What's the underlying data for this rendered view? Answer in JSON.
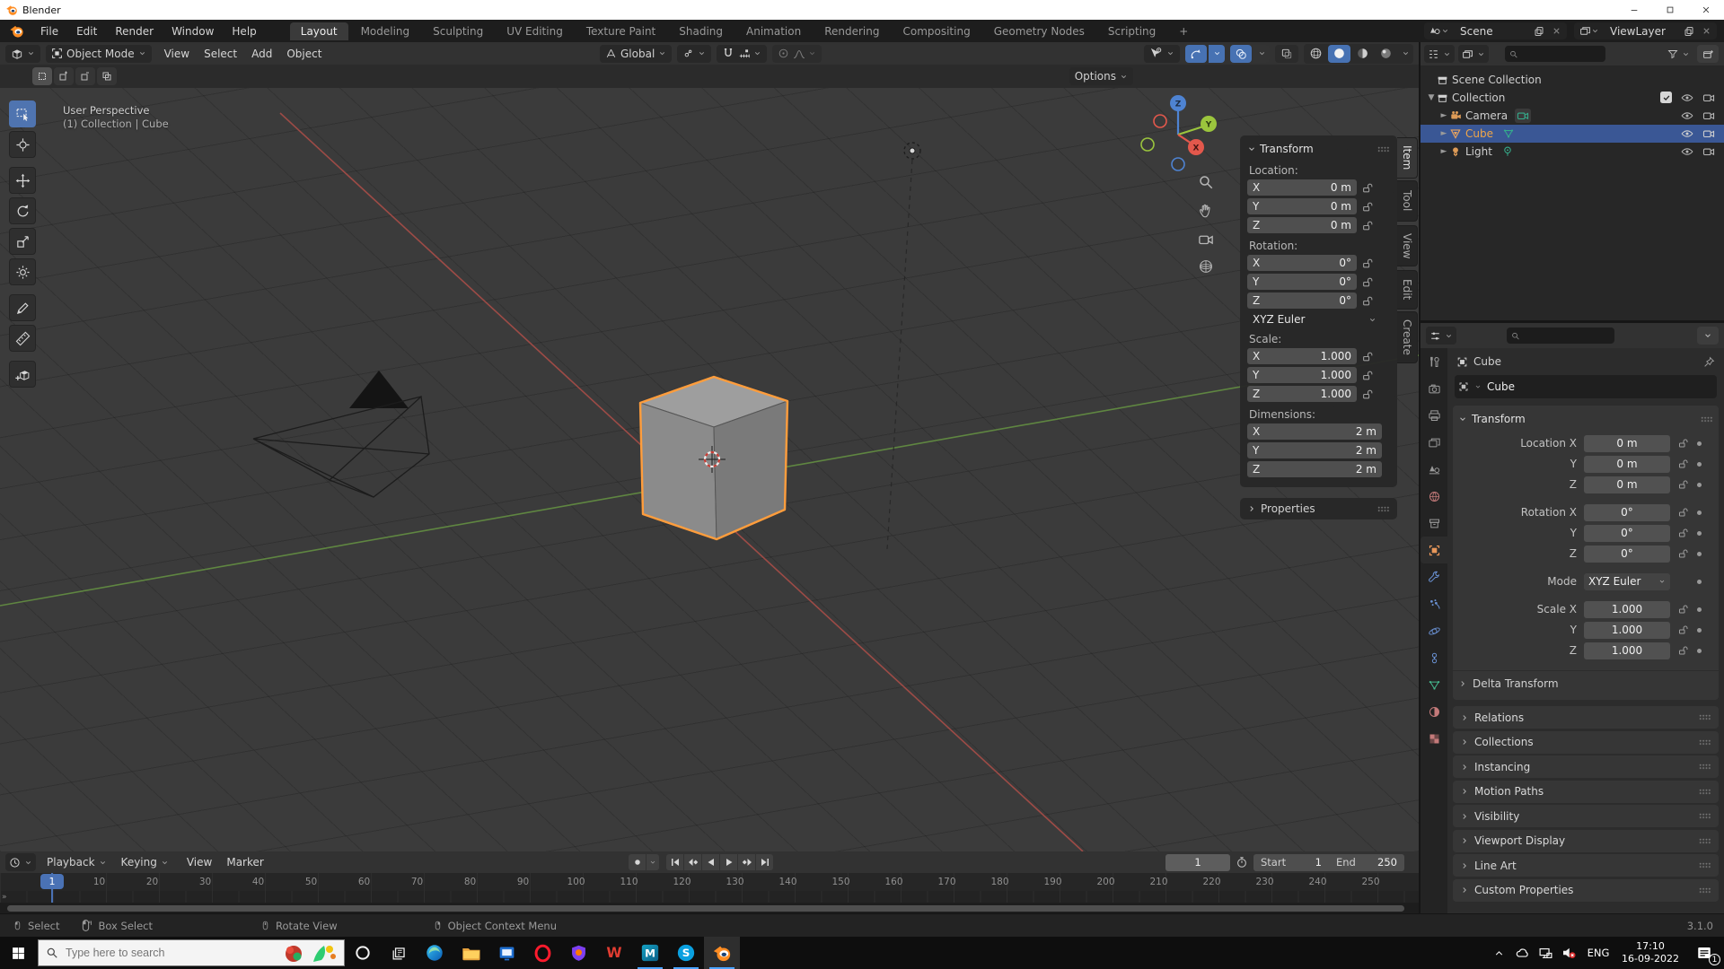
{
  "window": {
    "title": "Blender"
  },
  "icons": {
    "disclosure_open": "▼",
    "disclosure_closed": "►"
  },
  "colors": {
    "accent_blue": "#4772b3",
    "selection_orange": "#ff9d3c",
    "axis_x": "#e3584c",
    "axis_y": "#9bc53d",
    "axis_z": "#4e83d2"
  },
  "topbar": {
    "menus": [
      "File",
      "Edit",
      "Render",
      "Window",
      "Help"
    ],
    "active_tab": "Layout",
    "tabs": [
      "Modeling",
      "Sculpting",
      "UV Editing",
      "Texture Paint",
      "Shading",
      "Animation",
      "Rendering",
      "Compositing",
      "Geometry Nodes",
      "Scripting",
      "+"
    ],
    "scene_name": "Scene",
    "view_layer_name": "ViewLayer"
  },
  "viewport": {
    "mode": "Object Mode",
    "menus": [
      "View",
      "Select",
      "Add",
      "Object"
    ],
    "orientation": "Global",
    "options_label": "Options",
    "overlay": {
      "line1": "User Perspective",
      "line2": "(1) Collection | Cube"
    },
    "gizmo": {
      "x": "X",
      "y": "Y",
      "z": "Z"
    }
  },
  "n_panel": {
    "tabs": [
      "Item",
      "Tool",
      "View",
      "Edit",
      "Create"
    ],
    "transform_title": "Transform",
    "location_label": "Location:",
    "location_rows": [
      {
        "axis": "X",
        "value": "0 m"
      },
      {
        "axis": "Y",
        "value": "0 m"
      },
      {
        "axis": "Z",
        "value": "0 m"
      }
    ],
    "rotation_label": "Rotation:",
    "rotation_rows": [
      {
        "axis": "X",
        "value": "0°"
      },
      {
        "axis": "Y",
        "value": "0°"
      },
      {
        "axis": "Z",
        "value": "0°"
      }
    ],
    "rotation_mode": "XYZ Euler",
    "scale_label": "Scale:",
    "scale_rows": [
      {
        "axis": "X",
        "value": "1.000"
      },
      {
        "axis": "Y",
        "value": "1.000"
      },
      {
        "axis": "Z",
        "value": "1.000"
      }
    ],
    "dimensions_label": "Dimensions:",
    "dimension_rows": [
      {
        "axis": "X",
        "value": "2 m"
      },
      {
        "axis": "Y",
        "value": "2 m"
      },
      {
        "axis": "Z",
        "value": "2 m"
      }
    ],
    "properties_label": "Properties"
  },
  "outliner": {
    "rows": {
      "scene_collection": "Scene Collection",
      "collection": "Collection",
      "camera": "Camera",
      "cube": "Cube",
      "light": "Light"
    }
  },
  "properties": {
    "breadcrumb": "Cube",
    "object_name": "Cube",
    "transform_title": "Transform",
    "location_rows": [
      {
        "label": "Location X",
        "value": "0 m"
      },
      {
        "label": "Y",
        "value": "0 m"
      },
      {
        "label": "Z",
        "value": "0 m"
      }
    ],
    "rotation_rows": [
      {
        "label": "Rotation X",
        "value": "0°"
      },
      {
        "label": "Y",
        "value": "0°"
      },
      {
        "label": "Z",
        "value": "0°"
      }
    ],
    "mode_label": "Mode",
    "mode_value": "XYZ Euler",
    "scale_rows": [
      {
        "label": "Scale X",
        "value": "1.000"
      },
      {
        "label": "Y",
        "value": "1.000"
      },
      {
        "label": "Z",
        "value": "1.000"
      }
    ],
    "delta_label": "Delta Transform",
    "collapsed_panels": [
      "Relations",
      "Collections",
      "Instancing",
      "Motion Paths",
      "Visibility",
      "Viewport Display",
      "Line Art",
      "Custom Properties"
    ]
  },
  "timeline": {
    "dropdown_menus": [
      "Playback",
      "Keying"
    ],
    "plain_menus": [
      "View",
      "Marker"
    ],
    "frame_labels": [
      "10",
      "20",
      "30",
      "40",
      "50",
      "60",
      "70",
      "80",
      "90",
      "100",
      "110",
      "120",
      "130",
      "140",
      "150",
      "160",
      "170",
      "180",
      "190",
      "200",
      "210",
      "220",
      "230",
      "240",
      "250"
    ],
    "current_frame": "1",
    "start_label": "Start",
    "start_value": "1",
    "end_label": "End",
    "end_value": "250"
  },
  "status_bar": {
    "hints": [
      "Select",
      "Box Select",
      "Rotate View",
      "Object Context Menu"
    ],
    "version": "3.1.0"
  },
  "taskbar": {
    "search_placeholder": "Type here to search",
    "language": "ENG",
    "time": "17:10",
    "date": "16-09-2022",
    "notification_count": "1",
    "app_glyphs": {
      "wps": "W",
      "maya": "M",
      "skype": "S"
    },
    "apps": [
      "cortana",
      "task-view",
      "edge",
      "file-explorer",
      "movies-tv",
      "opera",
      "avast",
      "wps-office",
      "maya",
      "skype",
      "blender"
    ]
  }
}
